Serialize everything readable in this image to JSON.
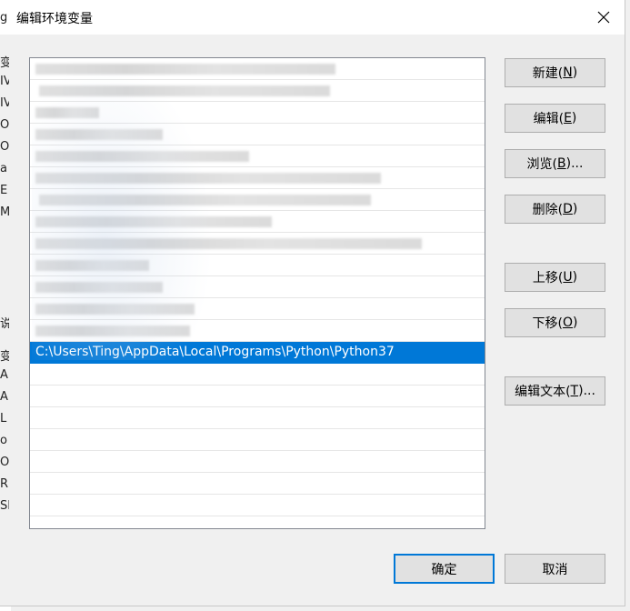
{
  "window": {
    "title": "编辑环境变量"
  },
  "background_fragments": [
    "g",
    "变",
    "IV",
    "IV",
    "Or",
    "Or",
    "a",
    "E",
    "M",
    "说",
    "变",
    "AN",
    "A",
    "L",
    "o",
    "Or",
    "R",
    "SF"
  ],
  "list": {
    "blurred_rows": 13,
    "selected_path": "C:\\Users\\Ting\\AppData\\Local\\Programs\\Python\\Python37",
    "empty_rows": 8
  },
  "buttons": {
    "new": {
      "label": "新建(",
      "key": "N",
      "end": ")"
    },
    "edit": {
      "label": "编辑(",
      "key": "E",
      "end": ")"
    },
    "browse": {
      "label": "浏览(",
      "key": "B",
      "end": ")..."
    },
    "delete": {
      "label": "删除(",
      "key": "D",
      "end": ")"
    },
    "move_up": {
      "label": "上移(",
      "key": "U",
      "end": ")"
    },
    "move_down": {
      "label": "下移(",
      "key": "O",
      "end": ")"
    },
    "edit_text": {
      "label": "编辑文本(",
      "key": "T",
      "end": ")..."
    },
    "ok": "确定",
    "cancel": "取消"
  }
}
